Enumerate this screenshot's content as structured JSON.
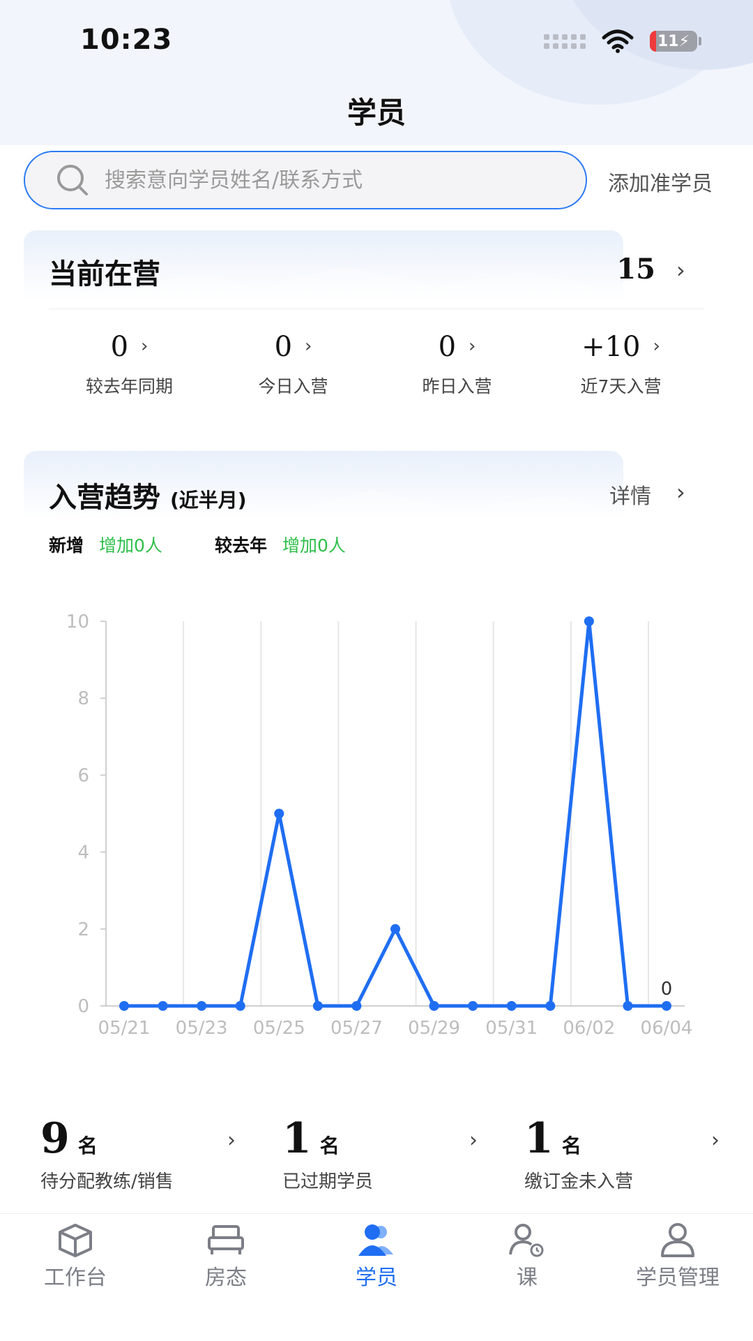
{
  "status_bar": {
    "time": "10:23",
    "battery": "11"
  },
  "header": {
    "title": "学员"
  },
  "search": {
    "placeholder": "搜索意向学员姓名/联系方式",
    "value": "",
    "add_label": "添加准学员"
  },
  "current": {
    "title": "当前在营",
    "total": "15",
    "stats": [
      {
        "value": "0",
        "label": "较去年同期"
      },
      {
        "value": "0",
        "label": "今日入营"
      },
      {
        "value": "0",
        "label": "昨日入营"
      },
      {
        "value": "+10",
        "label": "近7天入营"
      }
    ]
  },
  "trend": {
    "title": "入营趋势",
    "subtitle": "(近半月)",
    "detail_label": "详情",
    "new_label": "新增",
    "new_value": "增加0人",
    "yoy_label": "较去年",
    "yoy_value": "增加0人"
  },
  "chart_data": {
    "type": "line",
    "x": [
      "05/21",
      "05/22",
      "05/23",
      "05/24",
      "05/25",
      "05/26",
      "05/27",
      "05/28",
      "05/29",
      "05/30",
      "05/31",
      "06/01",
      "06/02",
      "06/03",
      "06/04"
    ],
    "x_tick_labels": [
      "05/21",
      "05/23",
      "05/25",
      "05/27",
      "05/29",
      "05/31",
      "06/02",
      "06/04"
    ],
    "series": [
      {
        "values": [
          0,
          0,
          0,
          0,
          5,
          0,
          0,
          2,
          0,
          0,
          0,
          0,
          10,
          0,
          0
        ]
      }
    ],
    "ylim": [
      0,
      10
    ],
    "y_ticks": [
      0,
      2,
      4,
      6,
      8,
      10
    ],
    "last_point_label": "0",
    "grid": true,
    "colors": {
      "line": "#1f6ef2",
      "grid": "#e6e6e6",
      "axis_text": "#bdbdbd"
    }
  },
  "summary": [
    {
      "num": "9",
      "unit": "名",
      "label": "待分配教练/销售"
    },
    {
      "num": "1",
      "unit": "名",
      "label": "已过期学员"
    },
    {
      "num": "1",
      "unit": "名",
      "label": "缴订金未入营"
    }
  ],
  "tabs": [
    {
      "label": "工作台",
      "icon": "cube-icon"
    },
    {
      "label": "房态",
      "icon": "bed-icon"
    },
    {
      "label": "学员",
      "icon": "users-icon",
      "active": true
    },
    {
      "label": "课",
      "icon": "user-clock-icon"
    },
    {
      "label": "学员管理",
      "icon": "user-icon"
    }
  ],
  "colors": {
    "accent": "#1f6ef2",
    "positive": "#2fbf4a"
  }
}
